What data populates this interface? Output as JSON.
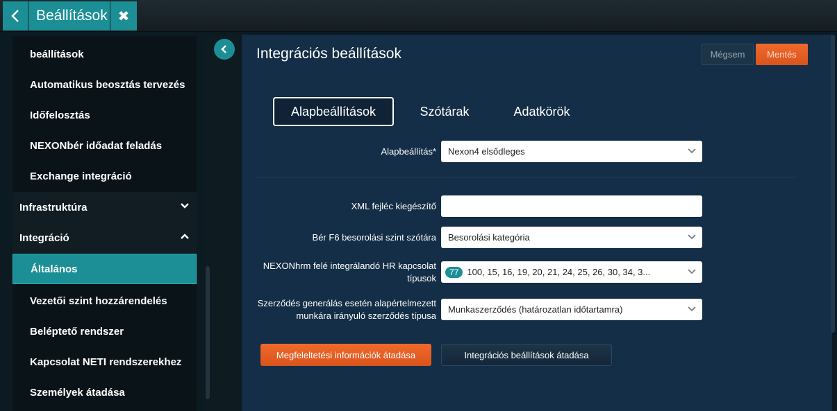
{
  "header": {
    "title": "Beállítások",
    "back_icon": "chevron-left-icon",
    "close_icon": "close-icon"
  },
  "sidebar": {
    "items": [
      {
        "label": "beállítások",
        "type": "sub"
      },
      {
        "label": "Automatikus beosztás tervezés",
        "type": "sub"
      },
      {
        "label": "Időfelosztás",
        "type": "sub"
      },
      {
        "label": "NEXONbér időadat feladás",
        "type": "sub"
      },
      {
        "label": "Exchange integráció",
        "type": "sub"
      },
      {
        "label": "Infrastruktúra",
        "type": "group",
        "expanded": false
      },
      {
        "label": "Integráció",
        "type": "group",
        "expanded": true
      },
      {
        "label": "Általános",
        "type": "active"
      },
      {
        "label": "Vezetői szint hozzárendelés",
        "type": "sub"
      },
      {
        "label": "Beléptető rendszer",
        "type": "sub"
      },
      {
        "label": "Kapcsolat NETI rendszerekhez",
        "type": "sub"
      },
      {
        "label": "Személyek átadása",
        "type": "sub"
      }
    ]
  },
  "main": {
    "title": "Integrációs beállítások",
    "cancel_label": "Mégsem",
    "save_label": "Mentés",
    "tabs": [
      {
        "label": "Alapbeállítások",
        "active": true
      },
      {
        "label": "Szótárak",
        "active": false
      },
      {
        "label": "Adatkörök",
        "active": false
      }
    ],
    "fields": {
      "alapbeallitas": {
        "label": "Alapbeállítás*",
        "value": "Nexon4 elsődleges"
      },
      "xml": {
        "label": "XML fejléc kiegészítő",
        "value": ""
      },
      "berf6": {
        "label": "Bér F6 besorolási szint szótára",
        "value": "Besorolási kategória"
      },
      "hr": {
        "label_line1": "NEXONhrm felé integrálandó HR kapcsolat",
        "label_line2": "típusok",
        "count": "77",
        "value": "100, 15, 16, 19, 20, 21, 24, 25, 26, 30, 34, 3..."
      },
      "szerzodes": {
        "label_line1": "Szerződés generálás esetén alapértelmezett",
        "label_line2": "munkára irányuló szerződés típusa",
        "value": "Munkaszerződés (határozatlan időtartamra)"
      }
    },
    "btn_megfeleltetesi": "Megfeleltetési információk átadása",
    "btn_integracios": "Integrációs beállítások átadása"
  },
  "colors": {
    "accent": "#1b8f95",
    "orange": "#e65f24",
    "panel": "#132e46"
  }
}
